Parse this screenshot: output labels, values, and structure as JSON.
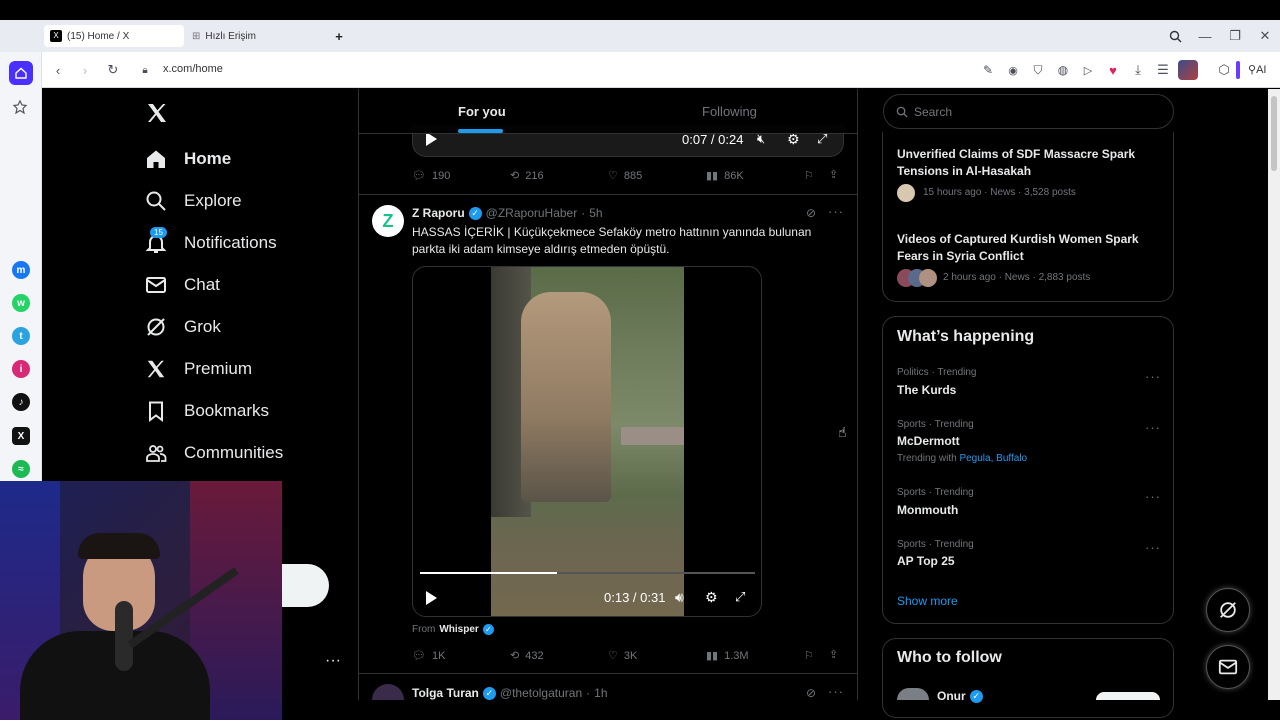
{
  "browser": {
    "tabs": [
      {
        "title": "(15) Home / X",
        "active": true
      },
      {
        "title": "Hızlı Erişim",
        "active": false
      }
    ],
    "new_tab": "+",
    "url": "x.com/home",
    "ai_label": "AI"
  },
  "nav": {
    "items": [
      {
        "label": "Home",
        "icon": "home-icon",
        "active": true
      },
      {
        "label": "Explore",
        "icon": "search-icon"
      },
      {
        "label": "Notifications",
        "icon": "bell-icon",
        "badge": "15"
      },
      {
        "label": "Chat",
        "icon": "mail-icon"
      },
      {
        "label": "Grok",
        "icon": "grok-icon"
      },
      {
        "label": "Premium",
        "icon": "x-icon"
      },
      {
        "label": "Bookmarks",
        "icon": "bookmark-icon"
      },
      {
        "label": "Communities",
        "icon": "communities-icon"
      }
    ],
    "more": "···"
  },
  "feed": {
    "tabs": [
      "For you",
      "Following"
    ],
    "prev_post": {
      "time": "0:07 / 0:24",
      "replies": "190",
      "reposts": "216",
      "likes": "885",
      "views": "86K"
    },
    "post": {
      "name": "Z Raporu",
      "handle": "@ZRaporuHaber",
      "dot": "·",
      "age": "5h",
      "avatar_letter": "Z",
      "text": "HASSAS İÇERİK | Küçükçekmece Sefaköy metro hattının yanında bulunan parkta iki adam kimseye aldırış etmeden öpüştü.",
      "video_time": "0:13 / 0:31",
      "from_label": "From",
      "from_name": "Whisper",
      "replies": "1K",
      "reposts": "432",
      "likes": "3K",
      "views": "1.3M"
    },
    "next_post": {
      "name": "Tolga Turan",
      "handle": "@thetolgaturan",
      "dot": "·",
      "age": "1h"
    }
  },
  "right": {
    "search_placeholder": "Search",
    "news": [
      {
        "title": "Unverified Claims of SDF Massacre Spark Tensions in Al-Hasakah",
        "meta": "15 hours ago · News · 3,528 posts"
      },
      {
        "title": "Videos of Captured Kurdish Women Spark Fears in Syria Conflict",
        "meta": "2 hours ago · News · 2,883 posts"
      }
    ],
    "happening_title": "What’s happening",
    "trends": [
      {
        "meta": "Politics · Trending",
        "name": "The Kurds"
      },
      {
        "meta": "Sports · Trending",
        "name": "McDermott",
        "with_label": "Trending with",
        "with_links": "Pegula, Buffalo"
      },
      {
        "meta": "Sports · Trending",
        "name": "Monmouth"
      },
      {
        "meta": "Sports · Trending",
        "name": "AP Top 25"
      }
    ],
    "show_more": "Show more",
    "who_to_follow": "Who to follow",
    "follow_name": "Onur"
  }
}
